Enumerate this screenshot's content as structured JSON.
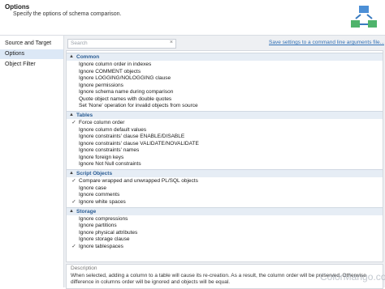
{
  "header": {
    "title": "Options",
    "subtitle": "Specify the options of schema comparison."
  },
  "nav": {
    "items": [
      {
        "label": "Source and Target",
        "selected": false
      },
      {
        "label": "Options",
        "selected": true
      },
      {
        "label": "Object Filter",
        "selected": false
      }
    ]
  },
  "search": {
    "placeholder": "Search",
    "clear_icon": "close-icon"
  },
  "save_link": "Save settings to a command line arguments file...",
  "sections": [
    {
      "label": "Common",
      "items": [
        {
          "label": "Ignore column order in indexes",
          "checked": false
        },
        {
          "label": "Ignore COMMENT objects",
          "checked": false
        },
        {
          "label": "Ignore LOGGING/NOLOGGING clause",
          "checked": false
        },
        {
          "label": "Ignore permissions",
          "checked": false
        },
        {
          "label": "Ignore schema name during comparison",
          "checked": false
        },
        {
          "label": "Quote object names with double quotes",
          "checked": false
        },
        {
          "label": "Set 'None' operation for invalid objects from source",
          "checked": false
        }
      ]
    },
    {
      "label": "Tables",
      "items": [
        {
          "label": "Force column order",
          "checked": true
        },
        {
          "label": "Ignore column default values",
          "checked": false
        },
        {
          "label": "Ignore constraints' clause ENABLE/DISABLE",
          "checked": false
        },
        {
          "label": "Ignore constraints' clause VALIDATE/NOVALIDATE",
          "checked": false
        },
        {
          "label": "Ignore constraints' names",
          "checked": false
        },
        {
          "label": "Ignore foreign keys",
          "checked": false
        },
        {
          "label": "Ignore Not Null constraints",
          "checked": false
        }
      ]
    },
    {
      "label": "Script Objects",
      "items": [
        {
          "label": "Compare wrapped and unwrapped PL/SQL objects",
          "checked": true
        },
        {
          "label": "Ignore case",
          "checked": false
        },
        {
          "label": "Ignore comments",
          "checked": false
        },
        {
          "label": "Ignore white spaces",
          "checked": true
        }
      ]
    },
    {
      "label": "Storage",
      "items": [
        {
          "label": "Ignore compressions",
          "checked": false
        },
        {
          "label": "Ignore partitions",
          "checked": false
        },
        {
          "label": "Ignore physical attributes",
          "checked": false
        },
        {
          "label": "Ignore storage clause",
          "checked": false
        },
        {
          "label": "Ignore tablespaces",
          "checked": true
        }
      ]
    }
  ],
  "description": {
    "heading": "Description",
    "text": "When selected, adding a column to a table will cause its re-creation. As a result, the column order will be preserved. Otherwise difference in columns order will be ignored and objects will be equal."
  },
  "watermark": "ColorMango.com",
  "colors": {
    "accent": "#2b5d94",
    "link": "#2f6fb5",
    "selected_nav": "#dce8f6"
  }
}
